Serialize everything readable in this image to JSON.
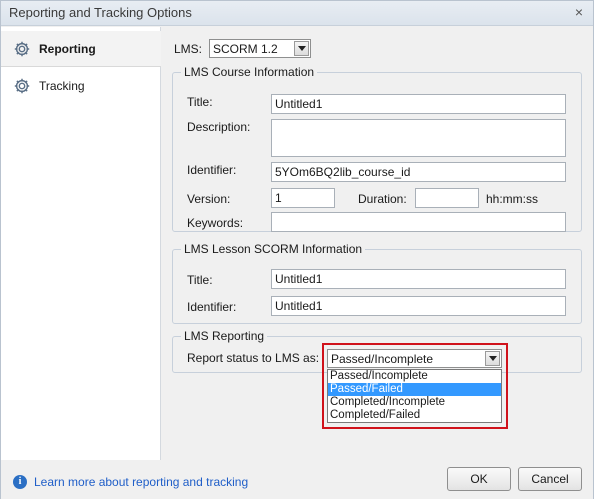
{
  "window": {
    "title": "Reporting and Tracking Options",
    "close_glyph": "×"
  },
  "sidebar": {
    "items": [
      {
        "label": "Reporting",
        "icon": "gear-icon",
        "active": true
      },
      {
        "label": "Tracking",
        "icon": "gear-icon",
        "active": false
      }
    ]
  },
  "lms": {
    "label": "LMS:",
    "value": "SCORM 1.2"
  },
  "course_info": {
    "legend": "LMS Course Information",
    "title_label": "Title:",
    "title_value": "Untitled1",
    "description_label": "Description:",
    "description_value": "",
    "identifier_label": "Identifier:",
    "identifier_value": "5YOm6BQ2lib_course_id",
    "version_label": "Version:",
    "version_value": "1",
    "duration_label": "Duration:",
    "duration_value": "",
    "duration_unit": "hh:mm:ss",
    "keywords_label": "Keywords:",
    "keywords_value": ""
  },
  "lesson_info": {
    "legend": "LMS Lesson SCORM Information",
    "title_label": "Title:",
    "title_value": "Untitled1",
    "identifier_label": "Identifier:",
    "identifier_value": "Untitled1"
  },
  "reporting": {
    "legend": "LMS Reporting",
    "status_label": "Report status to LMS as:",
    "status_value": "Passed/Incomplete",
    "options": [
      "Passed/Incomplete",
      "Passed/Failed",
      "Completed/Incomplete",
      "Completed/Failed"
    ],
    "highlighted_option": "Passed/Failed"
  },
  "footer": {
    "learn_more": "Learn more about reporting and tracking",
    "ok_label": "OK",
    "cancel_label": "Cancel"
  },
  "colors": {
    "highlight_border": "#d0121b",
    "selection": "#3399ff",
    "link": "#1f5ec8"
  }
}
